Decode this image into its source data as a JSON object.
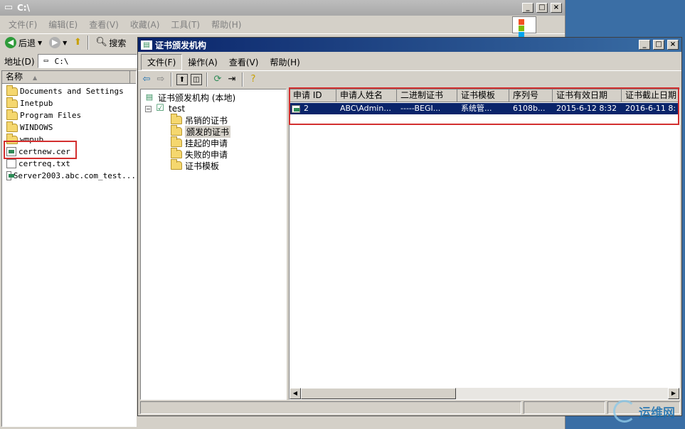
{
  "explorer": {
    "title": "C:\\",
    "menus": [
      "文件(F)",
      "编辑(E)",
      "查看(V)",
      "收藏(A)",
      "工具(T)",
      "帮助(H)"
    ],
    "toolbar": {
      "back": "后退",
      "search": "搜索"
    },
    "address_label": "地址(D)",
    "address_value": "C:\\",
    "column_name": "名称",
    "files": [
      {
        "name": "Documents and Settings",
        "icon": "folder-icon"
      },
      {
        "name": "Inetpub",
        "icon": "folder-icon"
      },
      {
        "name": "Program Files",
        "icon": "folder-icon"
      },
      {
        "name": "WINDOWS",
        "icon": "folder-icon"
      },
      {
        "name": "wmpub",
        "icon": "folder-icon"
      },
      {
        "name": "certnew.cer",
        "icon": "certificate-file-icon"
      },
      {
        "name": "certreq.txt",
        "icon": "text-file-icon"
      },
      {
        "name": "Server2003.abc.com_test...",
        "icon": "certificate-file-icon"
      }
    ]
  },
  "ca": {
    "title": "证书颁发机构",
    "menus": [
      "文件(F)",
      "操作(A)",
      "查看(V)",
      "帮助(H)"
    ],
    "tree": {
      "root": "证书颁发机构 (本地)",
      "node": "test",
      "children": [
        "吊销的证书",
        "颁发的证书",
        "挂起的申请",
        "失败的申请",
        "证书模板"
      ]
    },
    "columns": [
      "申请 ID",
      "申请人姓名",
      "二进制证书",
      "证书模板",
      "序列号",
      "证书有效日期",
      "证书截止日期"
    ],
    "rows": [
      [
        "2",
        "ABC\\Admin...",
        "-----BEGI...",
        "系统管...",
        "6108b...",
        "2015-6-12 8:32",
        "2016-6-11 8:"
      ]
    ]
  },
  "watermark": "运维网",
  "colors": {
    "titlebar_active": "#0a246a",
    "highlight_box": "#d32f2f",
    "desktop": "#3a6ea5"
  }
}
